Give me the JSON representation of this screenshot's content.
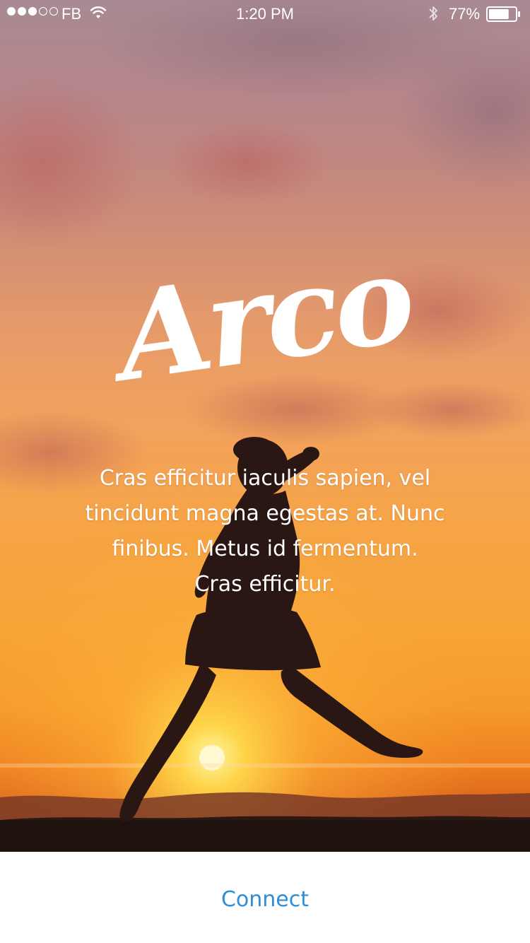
{
  "status_bar": {
    "signal_bars_filled": 3,
    "signal_bars_total": 5,
    "carrier": "FB",
    "wifi_icon": "wifi-icon",
    "time": "1:20 PM",
    "bluetooth_icon": "bluetooth-icon",
    "battery_percent": "77%",
    "battery_level": 0.77
  },
  "hero": {
    "logo_text": "Arco",
    "description": "Cras efficitur iaculis sapien, vel tincidunt magna egestas at. Nunc finibus. Metus id fermentum. Cras efficitur."
  },
  "footer": {
    "connect_label": "Connect"
  },
  "colors": {
    "accent": "#2e8fd6",
    "background": "#ffffff",
    "text_on_hero": "#ffffff"
  }
}
